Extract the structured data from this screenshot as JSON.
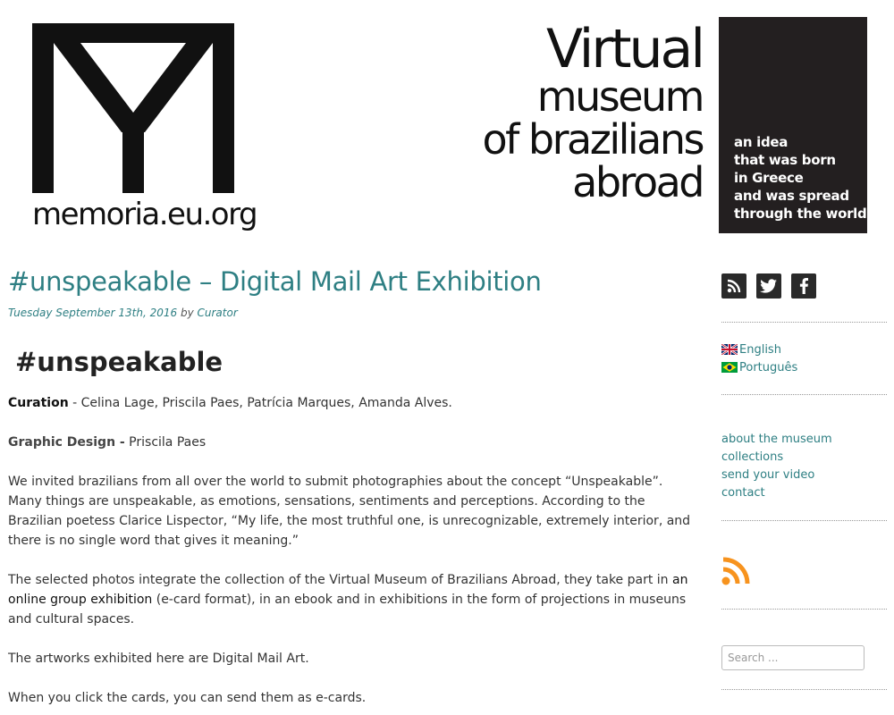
{
  "header": {
    "memoria_logo_text": "memoria.eu.org",
    "museum_title": {
      "line1": "Virtual",
      "line2": "museum",
      "line3": "of brazilians",
      "line4": "abroad"
    },
    "tagline": [
      "an idea",
      "that was born",
      "in Greece",
      "and was spread",
      "through the world"
    ]
  },
  "post": {
    "title": "#unspeakable – Digital Mail Art Exhibition",
    "date": "Tuesday September 13th, 2016",
    "by": "by",
    "author": "Curator",
    "heading": "#unspeakable",
    "curation_label": "Curation",
    "curation_text": " - Celina Lage, Priscila Paes, Patrícia Marques, Amanda Alves.",
    "design_label": "Graphic Design -",
    "design_text": " Priscila Paes",
    "invite_text": "We invited brazilians from all over the world to submit photographies about the concept “Unspeakable”. Many things are unspeakable, as emotions, sensations, sentiments and perceptions. According to the Brazilian poetess Clarice Lispector,  “My life, the most truthful one, is unrecognizable, extremely interior, and there is no single word that gives it meaning.”",
    "selected_part1": "The selected photos integrate the collection of the Virtual Museum of Brazilians Abroad, they take part in ",
    "selected_link": "an online group exhibition",
    "selected_part2": " (e-card format), in an ebook and in exhibitions in the form of projections in museuns and cultural spaces.",
    "artworks_text": "The artworks exhibited here are Digital Mail Art.",
    "click_text": "When you click the cards, you can send them as e-cards."
  },
  "sidebar": {
    "social_icons": [
      "rss-icon",
      "twitter-icon",
      "facebook-icon"
    ],
    "languages": [
      {
        "label": "English",
        "flag": "uk-flag-icon"
      },
      {
        "label": "Português",
        "flag": "brazil-flag-icon"
      }
    ],
    "nav": {
      "about": "about the museum",
      "collections": "collections",
      "send_video": "send your video",
      "contact": "contact"
    },
    "search_placeholder": "Search ..."
  },
  "colors": {
    "accent": "#2e7f83",
    "dark_box": "#231f20",
    "rss_orange": "#f7931e"
  }
}
